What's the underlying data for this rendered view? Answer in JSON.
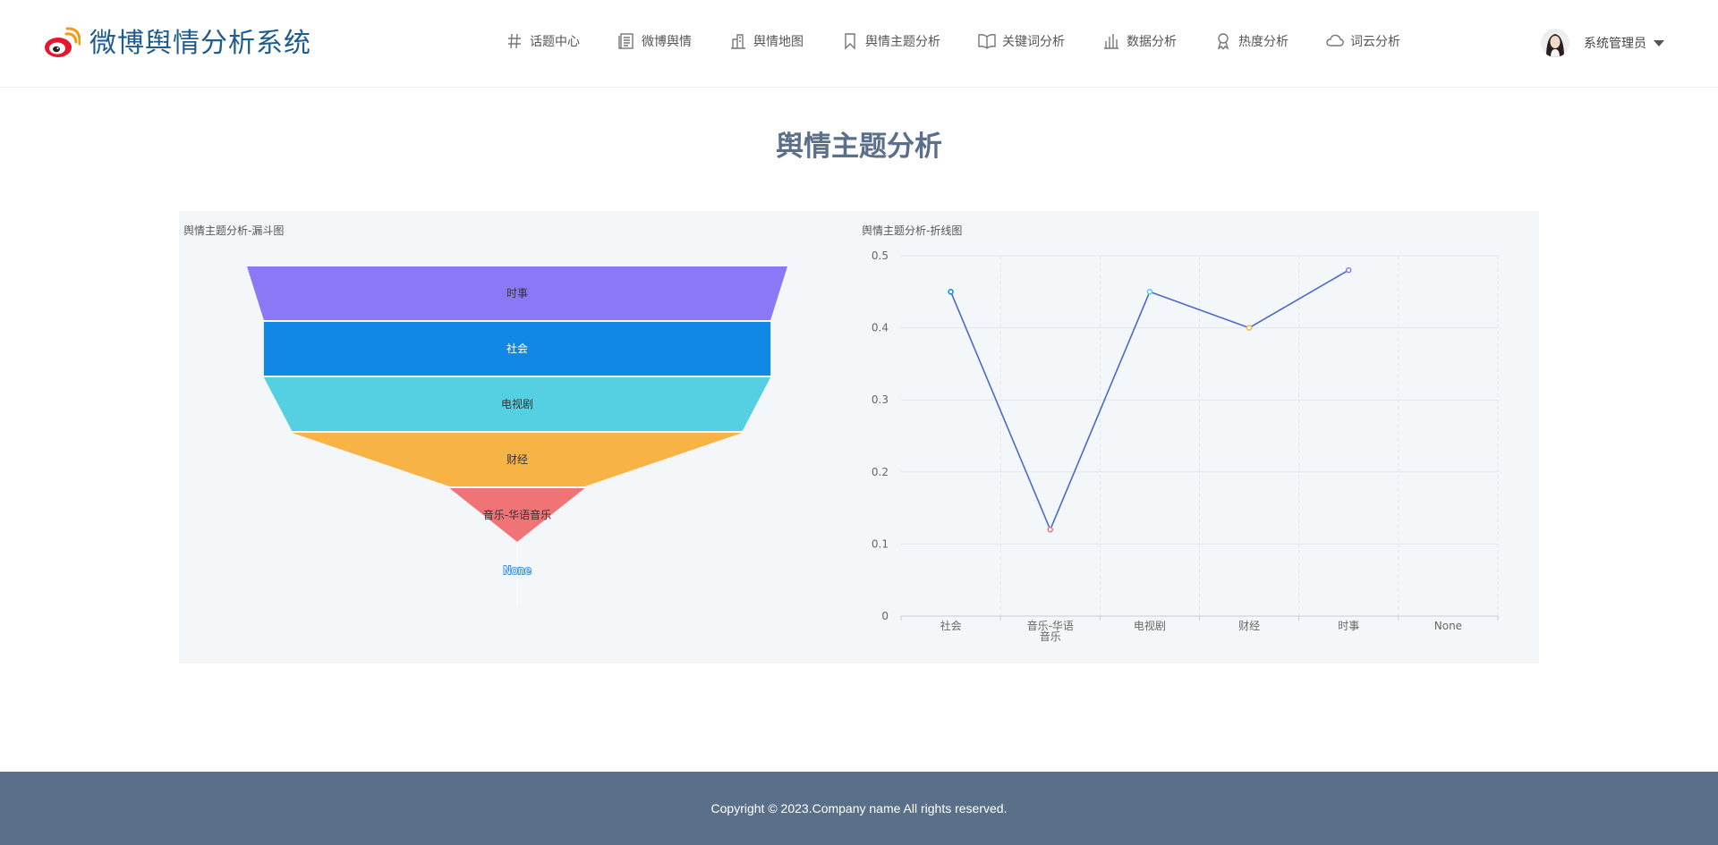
{
  "app": {
    "name": "微博舆情分析系统"
  },
  "nav": [
    {
      "label": "话题中心",
      "icon": "hash-icon"
    },
    {
      "label": "微博舆情",
      "icon": "document-icon"
    },
    {
      "label": "舆情地图",
      "icon": "buildings-icon"
    },
    {
      "label": "舆情主题分析",
      "icon": "bookmark-icon"
    },
    {
      "label": "关键词分析",
      "icon": "book-icon"
    },
    {
      "label": "数据分析",
      "icon": "bar-chart-icon"
    },
    {
      "label": "热度分析",
      "icon": "ribbon-icon"
    },
    {
      "label": "词云分析",
      "icon": "cloud-icon"
    }
  ],
  "user": {
    "name": "系统管理员"
  },
  "page": {
    "title": "舆情主题分析"
  },
  "funnel": {
    "title": "舆情主题分析-漏斗图"
  },
  "line": {
    "title": "舆情主题分析-折线图"
  },
  "chart_data": [
    {
      "type": "funnel",
      "title": "舆情主题分析-漏斗图",
      "categories": [
        "时事",
        "社会",
        "电视剧",
        "财经",
        "音乐-华语音乐",
        "None"
      ],
      "values": [
        0.48,
        0.45,
        0.45,
        0.4,
        0.12,
        0
      ],
      "colors": [
        "#8b78f6",
        "#1188e6",
        "#55d0e3",
        "#f8b347",
        "#f07376",
        "#3a8ee6"
      ]
    },
    {
      "type": "line",
      "title": "舆情主题分析-折线图",
      "categories": [
        "社会",
        "音乐-华语音乐",
        "电视剧",
        "财经",
        "时事",
        "None"
      ],
      "values": [
        0.45,
        0.12,
        0.45,
        0.4,
        0.48,
        null
      ],
      "ylim": [
        0,
        0.5
      ],
      "yticks": [
        "0",
        "0.1",
        "0.2",
        "0.3",
        "0.4",
        "0.5"
      ],
      "grid": true,
      "line_color": "#4a6ac8",
      "point_colors": [
        "#1188e6",
        "#f07376",
        "#55d0e3",
        "#f8b347",
        "#8b78f6"
      ]
    }
  ],
  "footer": {
    "copyright": "Copyright © 2023.Company name All rights reserved."
  }
}
